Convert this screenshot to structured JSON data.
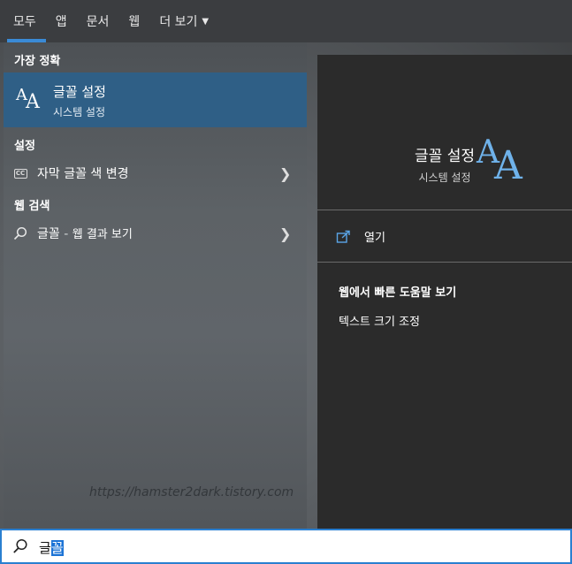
{
  "tabs": [
    {
      "label": "모두"
    },
    {
      "label": "앱"
    },
    {
      "label": "문서"
    },
    {
      "label": "웹"
    },
    {
      "label": "더 보기"
    }
  ],
  "left": {
    "best_match_header": "가장 정확",
    "best_match": {
      "title": "글꼴 설정",
      "subtitle": "시스템 설정",
      "icon": "font-aa-icon"
    },
    "settings_header": "설정",
    "settings_item": {
      "label": "자막 글꼴 색 변경",
      "icon": "closed-caption-icon"
    },
    "web_header": "웹 검색",
    "web_item": {
      "query": "글꼴",
      "separator": "-",
      "label": "웹 결과 보기",
      "icon": "search-icon"
    }
  },
  "watermark": "https://hamster2dark.tistory.com",
  "right": {
    "title": "글꼴 설정",
    "subtitle": "시스템 설정",
    "open_label": "열기",
    "quick_help_title": "웹에서 빠른 도움말 보기",
    "quick_help_item": "텍스트 크기 조정"
  },
  "search": {
    "typed": "글",
    "selected": "꼴"
  },
  "colors": {
    "accent": "#3a8ad6",
    "selected_row": "#2f5f86",
    "right_panel": "#2b2b2b",
    "icon_blue": "#6fb2ea"
  }
}
